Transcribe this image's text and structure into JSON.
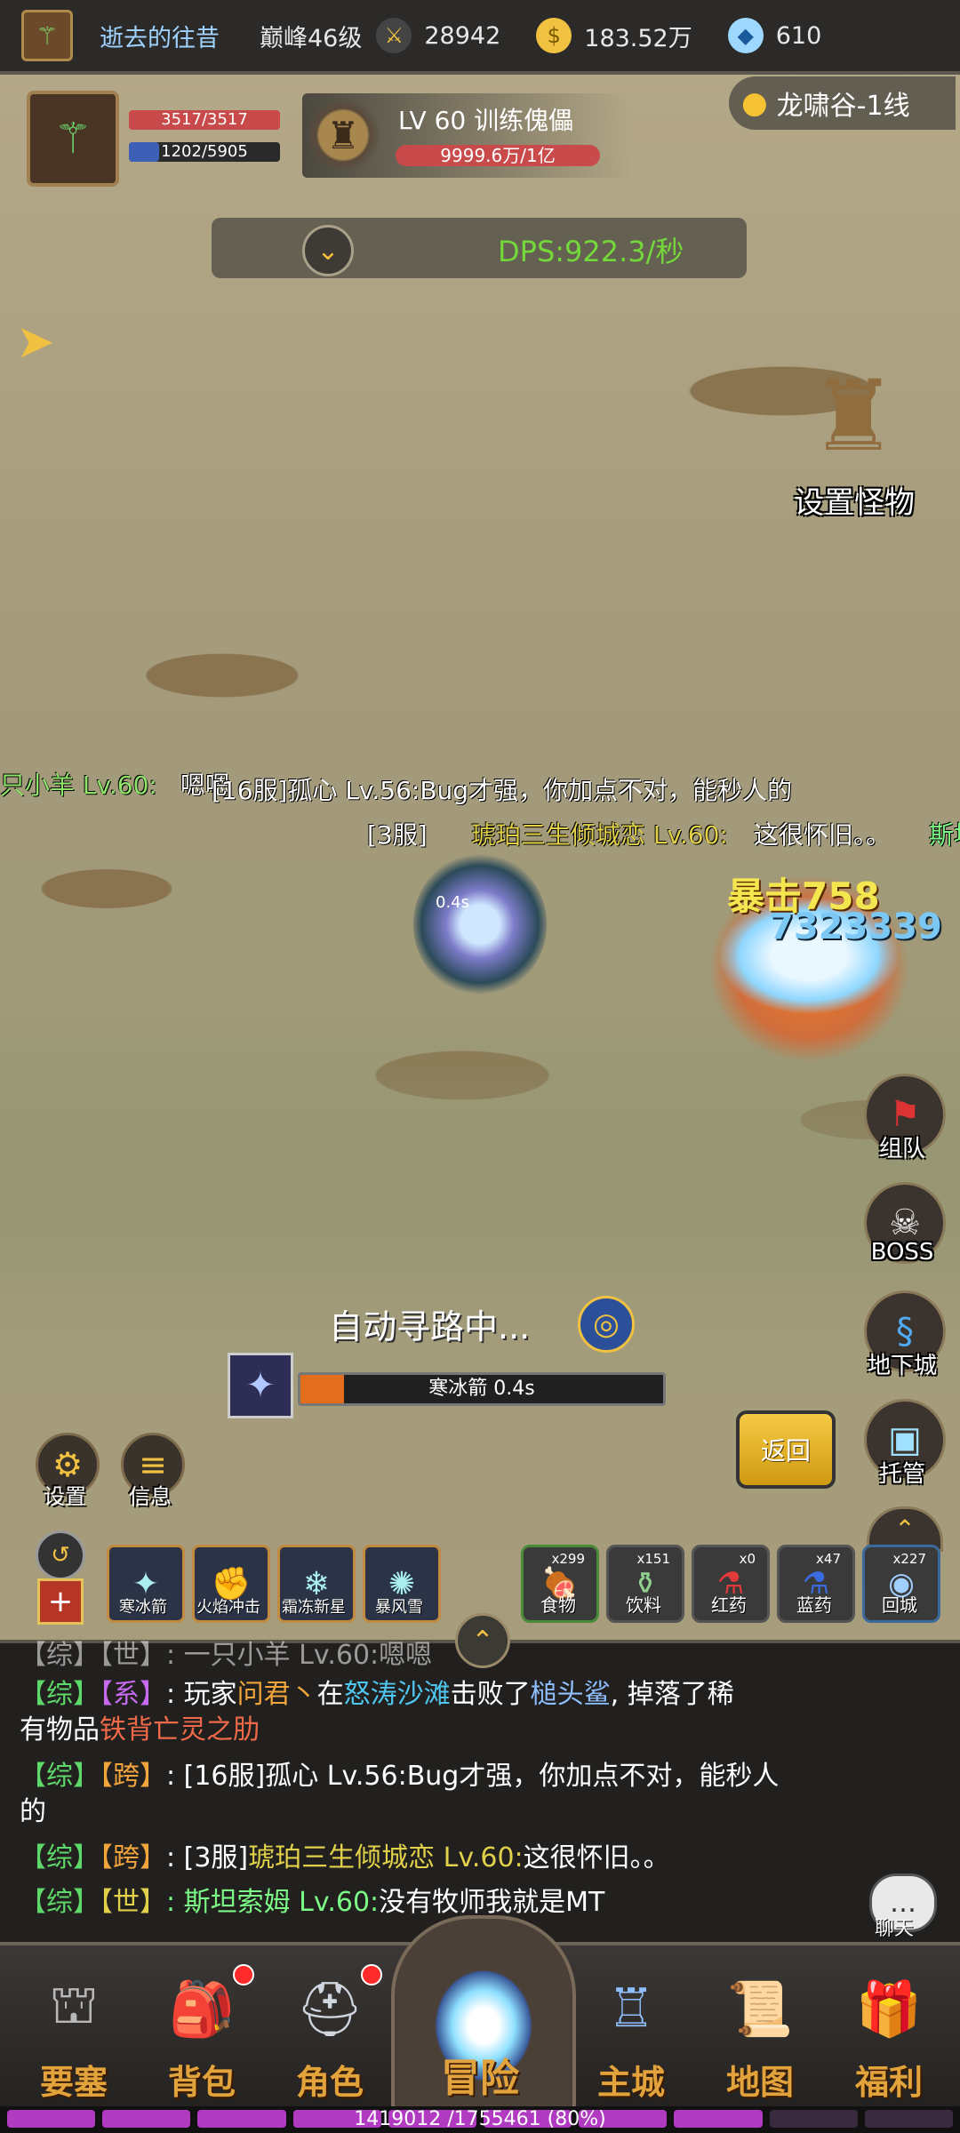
{
  "topbar": {
    "player_name": "逝去的往昔",
    "peak_level": "巅峰46级",
    "honor": "28942",
    "gold": "183.52万",
    "diamonds": "610"
  },
  "player": {
    "hp": "3517/3517",
    "mp": "1202/5905",
    "mp_fraction": 0.2
  },
  "target": {
    "name": "LV 60 训练傀儡",
    "hp": "9999.6万/1亿"
  },
  "location": "龙啸谷-1线",
  "dps": "DPS:922.3/秒",
  "set_monster": "设置怪物",
  "floating_chat": {
    "line1_name": "只小羊 Lv.60:",
    "line1_text": "嗯嗯",
    "line2": "[16服]孤心 Lv.56:Bug才强，你加点不对，能秒人的",
    "line3_prefix": "[3服]",
    "line3_name": "琥珀三生倾城恋 Lv.60:",
    "line3_text": "这很怀旧。。",
    "line3_tail": "斯坦索"
  },
  "battle": {
    "hero_cooldown": "0.4s",
    "crit_text": "暴击758",
    "crit_number": "7323339"
  },
  "right_menu": [
    {
      "label": "组队",
      "icon": "banner-icon"
    },
    {
      "label": "BOSS",
      "icon": "skull-icon"
    },
    {
      "label": "地下城",
      "icon": "dungeon-icon"
    },
    {
      "label": "托管",
      "icon": "monitor-icon"
    }
  ],
  "auto_path": "自动寻路中...",
  "cast": {
    "skill": "寒冰箭 0.4s",
    "progress": 0.12
  },
  "return_label": "返回",
  "left_menu": {
    "settings": "设置",
    "info": "信息"
  },
  "skills": [
    {
      "label": "寒冰箭"
    },
    {
      "label": "火焰冲击"
    },
    {
      "label": "霜冻新星"
    },
    {
      "label": "暴风雪"
    }
  ],
  "items": [
    {
      "label": "食物",
      "count": "x299"
    },
    {
      "label": "饮料",
      "count": "x151"
    },
    {
      "label": "红药",
      "count": "x0"
    },
    {
      "label": "蓝药",
      "count": "x47"
    },
    {
      "label": "回城",
      "count": "x227"
    }
  ],
  "chat": {
    "l0": "【综】【世】:  一只小羊 Lv.60:嗯嗯",
    "l1_tag1": "【综】",
    "l1_tag2": "【系】",
    "l1_a": ": 玩家",
    "l1_player": "问君丶",
    "l1_b": "在",
    "l1_place": "怒涛沙滩",
    "l1_c": "击败了",
    "l1_boss": "槌头鲨",
    "l1_d": ", 掉落了稀",
    "l1_e": "有物品",
    "l1_item": "铁背亡灵之肋",
    "l2_tag1": "【综】",
    "l2_tag2": "【跨】",
    "l2_text": ": [16服]孤心 Lv.56:Bug才强，你加点不对，能秒人",
    "l2_wrap": "的",
    "l3_tag1": "【综】",
    "l3_tag2": "【跨】",
    "l3_prefix": ": [3服]",
    "l3_name": "琥珀三生倾城恋 Lv.60:",
    "l3_text": "这很怀旧。。",
    "l4_tag1": "【综】",
    "l4_tag2": "【世】",
    "l4_name": ": 斯坦索姆 Lv.60:",
    "l4_text": "没有牧师我就是MT",
    "chat_button": "聊天"
  },
  "nav": [
    {
      "label": "要塞",
      "icon": "fortress-icon"
    },
    {
      "label": "背包",
      "icon": "backpack-icon"
    },
    {
      "label": "角色",
      "icon": "helmet-icon"
    },
    {
      "label": "冒险",
      "icon": "portal-icon"
    },
    {
      "label": "主城",
      "icon": "castle-icon"
    },
    {
      "label": "地图",
      "icon": "scroll-map-icon"
    },
    {
      "label": "福利",
      "icon": "gift-icon"
    }
  ],
  "exp": {
    "text": "1419012 /1755461 (80%)",
    "fraction": 0.8
  }
}
